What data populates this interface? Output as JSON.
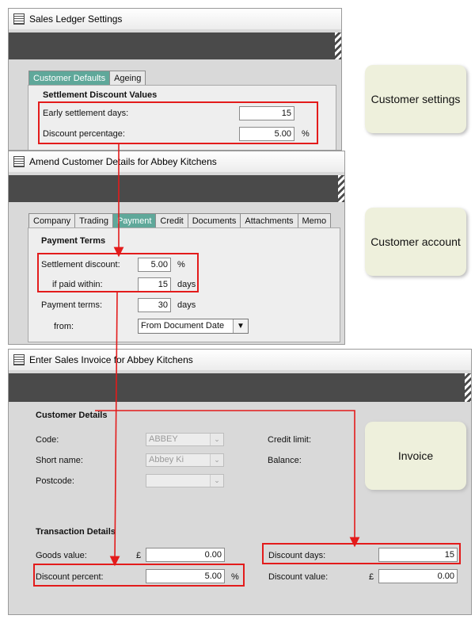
{
  "window1": {
    "title": "Sales Ledger Settings",
    "tabs": [
      "Customer Defaults",
      "Ageing"
    ],
    "section": "Settlement Discount Values",
    "early_days_label": "Early settlement days:",
    "early_days_value": "15",
    "discount_pct_label": "Discount percentage:",
    "discount_pct_value": "5.00",
    "pct_unit": "%"
  },
  "window2": {
    "title": "Amend Customer Details for Abbey Kitchens",
    "tabs": [
      "Company",
      "Trading",
      "Payment",
      "Credit",
      "Documents",
      "Attachments",
      "Memo"
    ],
    "section": "Payment Terms",
    "settlement_discount_label": "Settlement discount:",
    "settlement_discount_value": "5.00",
    "pct_unit": "%",
    "if_paid_label": "if paid within:",
    "if_paid_value": "15",
    "days_unit": "days",
    "payment_terms_label": "Payment terms:",
    "payment_terms_value": "30",
    "from_label": "from:",
    "from_value": "From Document Date"
  },
  "window3": {
    "title": "Enter Sales Invoice for Abbey Kitchens",
    "customer_section": "Customer Details",
    "code_label": "Code:",
    "code_value": "ABBEY",
    "short_name_label": "Short name:",
    "short_name_value": "Abbey Ki",
    "postcode_label": "Postcode:",
    "credit_limit_label": "Credit limit:",
    "balance_label": "Balance:",
    "transaction_section": "Transaction Details",
    "goods_value_label": "Goods value:",
    "currency": "£",
    "goods_value": "0.00",
    "discount_percent_label": "Discount percent:",
    "discount_percent_value": "5.00",
    "pct_unit": "%",
    "discount_days_label": "Discount days:",
    "discount_days_value": "15",
    "discount_value_label": "Discount value:",
    "discount_value": "0.00"
  },
  "notes": {
    "customer_settings": "Customer settings",
    "customer_account": "Customer account",
    "invoice": "Invoice"
  },
  "colors": {
    "highlight": "#e31b1b",
    "active_tab": "#5fa89a",
    "note_bg": "#eef0dc"
  }
}
